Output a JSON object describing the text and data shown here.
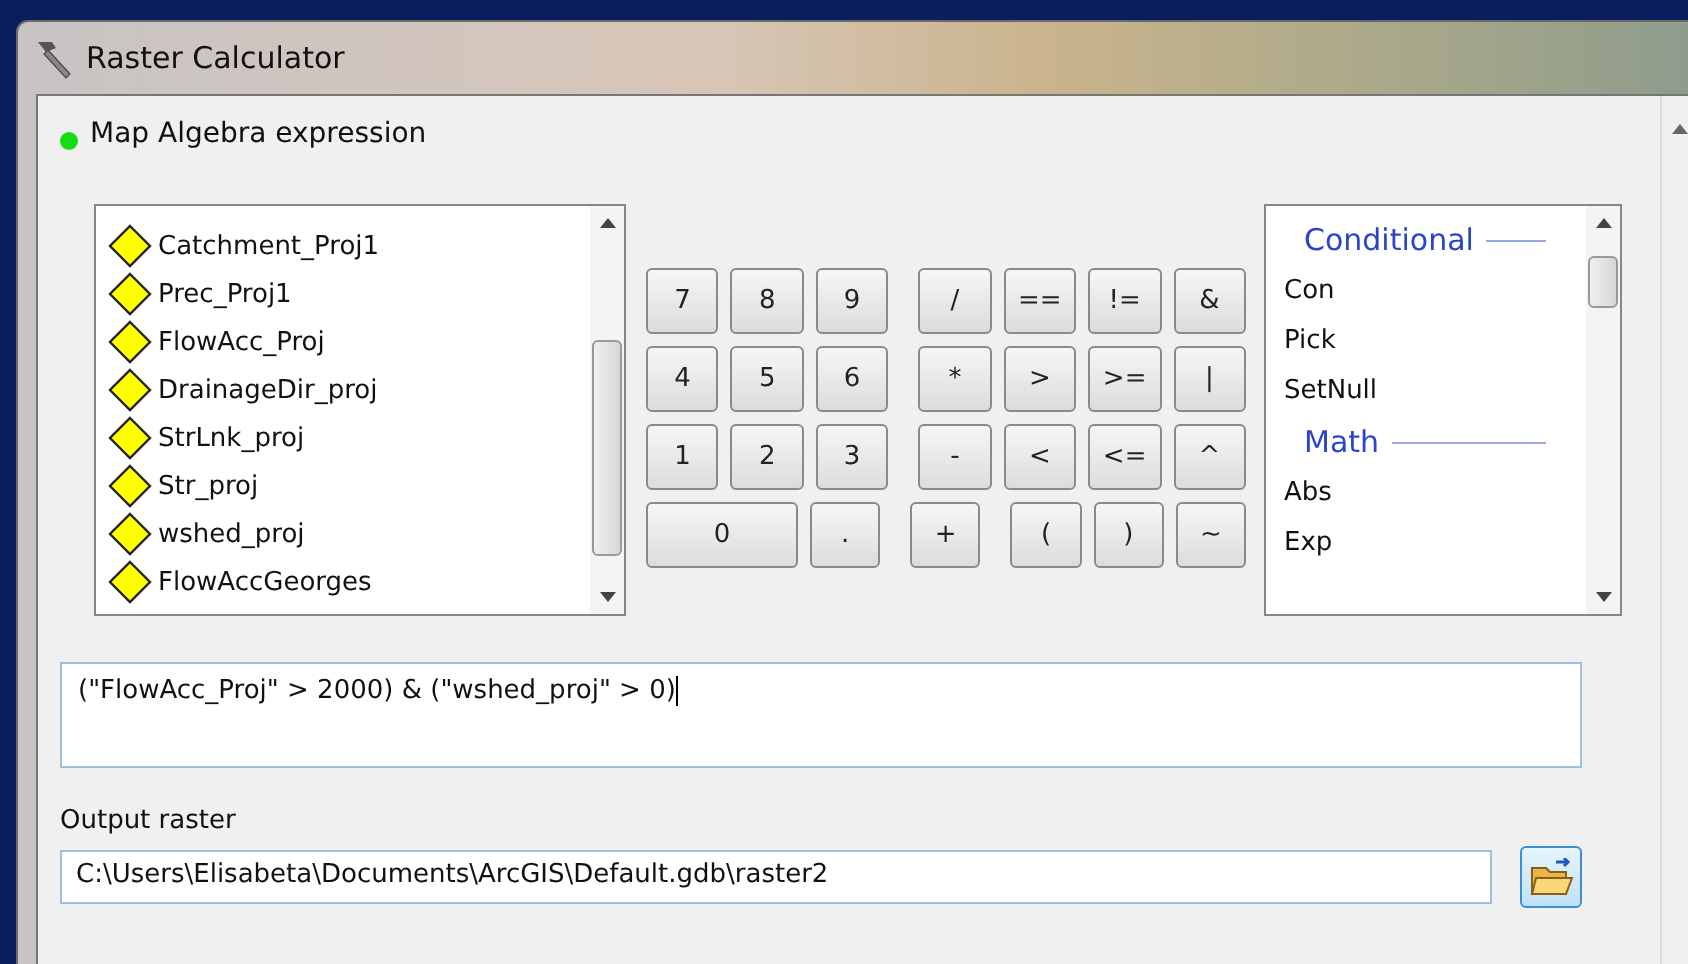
{
  "window": {
    "title": "Raster Calculator"
  },
  "section": {
    "label": "Map Algebra expression"
  },
  "layers": [
    {
      "name": "Catchment_Proj1"
    },
    {
      "name": "Prec_Proj1"
    },
    {
      "name": "FlowAcc_Proj"
    },
    {
      "name": "DrainageDir_proj"
    },
    {
      "name": "StrLnk_proj"
    },
    {
      "name": "Str_proj"
    },
    {
      "name": "wshed_proj"
    },
    {
      "name": "FlowAccGeorges"
    }
  ],
  "keypad": [
    [
      {
        "label": "7",
        "kind": "digit"
      },
      {
        "label": "8",
        "kind": "digit"
      },
      {
        "label": "9",
        "kind": "digit"
      },
      {
        "label": "/",
        "kind": "op"
      },
      {
        "label": "==",
        "kind": "op"
      },
      {
        "label": "!=",
        "kind": "op"
      },
      {
        "label": "&",
        "kind": "op"
      }
    ],
    [
      {
        "label": "4",
        "kind": "digit"
      },
      {
        "label": "5",
        "kind": "digit"
      },
      {
        "label": "6",
        "kind": "digit"
      },
      {
        "label": "*",
        "kind": "op"
      },
      {
        "label": ">",
        "kind": "op"
      },
      {
        "label": ">=",
        "kind": "op"
      },
      {
        "label": "|",
        "kind": "op"
      }
    ],
    [
      {
        "label": "1",
        "kind": "digit"
      },
      {
        "label": "2",
        "kind": "digit"
      },
      {
        "label": "3",
        "kind": "digit"
      },
      {
        "label": "-",
        "kind": "op"
      },
      {
        "label": "<",
        "kind": "op"
      },
      {
        "label": "<=",
        "kind": "op"
      },
      {
        "label": "^",
        "kind": "op"
      }
    ],
    [
      {
        "label": "0",
        "kind": "wide"
      },
      {
        "label": ".",
        "kind": "digit"
      },
      {
        "label": "+",
        "kind": "op"
      },
      {
        "label": "(",
        "kind": "op"
      },
      {
        "label": ")",
        "kind": "op"
      },
      {
        "label": "~",
        "kind": "op"
      }
    ]
  ],
  "functions": [
    {
      "kind": "header",
      "label": "Conditional"
    },
    {
      "kind": "item",
      "label": "Con"
    },
    {
      "kind": "item",
      "label": "Pick"
    },
    {
      "kind": "item",
      "label": "SetNull"
    },
    {
      "kind": "header",
      "label": "Math"
    },
    {
      "kind": "item",
      "label": "Abs"
    },
    {
      "kind": "item",
      "label": "Exp"
    }
  ],
  "expression": {
    "value": "(\"FlowAcc_Proj\" > 2000) & (\"wshed_proj\" > 0)"
  },
  "output": {
    "label": "Output raster",
    "value": "C:\\Users\\Elisabeta\\Documents\\ArcGIS\\Default.gdb\\raster2"
  }
}
